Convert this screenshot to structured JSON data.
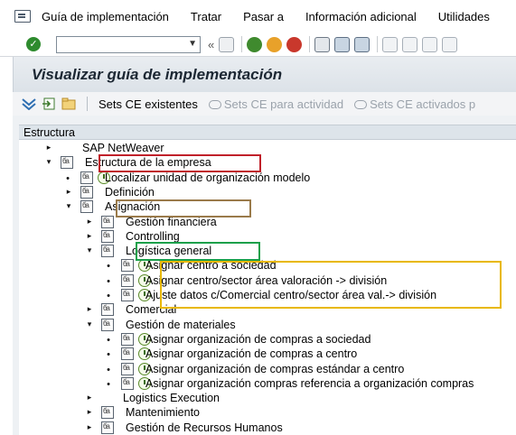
{
  "menubar": {
    "items": [
      "Guía de implementación",
      "Tratar",
      "Pasar a",
      "Información adicional",
      "Utilidades"
    ]
  },
  "toolbar": {
    "command_value": "",
    "back_glyph": "«"
  },
  "title": "Visualizar guía de implementación",
  "app_toolbar": {
    "sets_existing": "Sets CE existentes",
    "sets_activity": "Sets CE para actividad",
    "sets_active": "Sets CE activados p"
  },
  "tree_header": "Estructura",
  "tree": [
    {
      "level": 0,
      "expander": "▸",
      "doc": false,
      "clock": false,
      "label": "SAP NetWeaver"
    },
    {
      "level": 0,
      "expander": "▾",
      "doc": true,
      "clock": false,
      "label": "Estructura de la empresa"
    },
    {
      "level": 1,
      "expander": "•",
      "doc": true,
      "clock": true,
      "label": "Localizar unidad de organización modelo"
    },
    {
      "level": 1,
      "expander": "▸",
      "doc": true,
      "clock": false,
      "label": "Definición"
    },
    {
      "level": 1,
      "expander": "▾",
      "doc": true,
      "clock": false,
      "label": "Asignación"
    },
    {
      "level": 2,
      "expander": "▸",
      "doc": true,
      "clock": false,
      "label": "Gestión financiera"
    },
    {
      "level": 2,
      "expander": "▸",
      "doc": true,
      "clock": false,
      "label": "Controlling"
    },
    {
      "level": 2,
      "expander": "▾",
      "doc": true,
      "clock": false,
      "label": "Logística general"
    },
    {
      "level": 3,
      "expander": "•",
      "doc": true,
      "clock": true,
      "label": "Asignar centro a sociedad"
    },
    {
      "level": 3,
      "expander": "•",
      "doc": true,
      "clock": true,
      "label": "Asignar centro/sector área valoración -> división"
    },
    {
      "level": 3,
      "expander": "•",
      "doc": true,
      "clock": true,
      "label": "Ajuste datos c/Comercial centro/sector área val.-> división"
    },
    {
      "level": 2,
      "expander": "▸",
      "doc": true,
      "clock": false,
      "label": "Comercial"
    },
    {
      "level": 2,
      "expander": "▾",
      "doc": true,
      "clock": false,
      "label": "Gestión de materiales"
    },
    {
      "level": 3,
      "expander": "•",
      "doc": true,
      "clock": true,
      "label": "Asignar organización de compras a sociedad"
    },
    {
      "level": 3,
      "expander": "•",
      "doc": true,
      "clock": true,
      "label": "Asignar organización de compras a centro"
    },
    {
      "level": 3,
      "expander": "•",
      "doc": true,
      "clock": true,
      "label": "Asignar organización de compras estándar a centro"
    },
    {
      "level": 3,
      "expander": "•",
      "doc": true,
      "clock": true,
      "label": "Asignar organización compras referencia a organización compras"
    },
    {
      "level": 2,
      "expander": "▸",
      "doc": false,
      "clock": false,
      "label": "Logistics Execution"
    },
    {
      "level": 2,
      "expander": "▸",
      "doc": true,
      "clock": false,
      "label": "Mantenimiento"
    },
    {
      "level": 2,
      "expander": "▸",
      "doc": true,
      "clock": false,
      "label": "Gestión de Recursos Humanos"
    }
  ],
  "highlight_colors": {
    "estructura": "#c0202a",
    "asignacion": "#9a7a4a",
    "logistica": "#1aa04a",
    "activities": "#e8b800"
  }
}
